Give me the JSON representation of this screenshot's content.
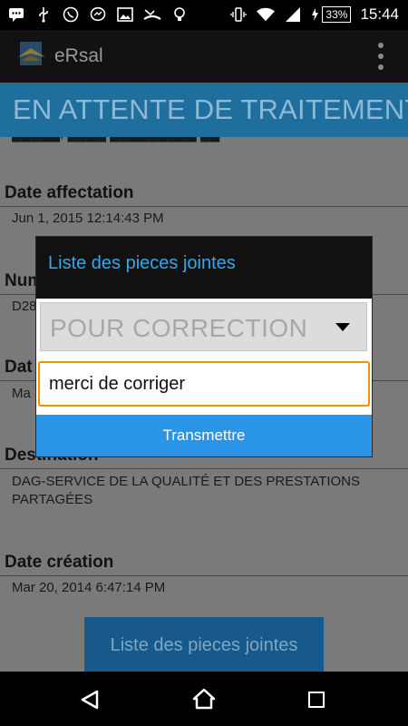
{
  "status_bar": {
    "notification_icons": [
      "chat-icon",
      "usb-icon",
      "whatsapp-icon",
      "messenger-icon",
      "image-icon",
      "missed-call-icon",
      "lightbulb-icon"
    ],
    "system_icons": [
      "vibrate-icon",
      "wifi-icon",
      "signal-icon",
      "battery-icon"
    ],
    "battery_percent": "33%",
    "time": "15:44"
  },
  "app_bar": {
    "title": "eRsal"
  },
  "banner": {
    "title": "EN ATTENTE DE TRAITEMENT"
  },
  "content": {
    "fields": [
      {
        "label": "Date affectation",
        "value": "Jun 1, 2015 12:14:43 PM"
      },
      {
        "label": "Numero d'ordre",
        "value": "D28"
      },
      {
        "label": "Dat",
        "value": "Ma"
      },
      {
        "label": "Destination",
        "value": "DAG-SERVICE DE LA QUALITÉ ET  DES PRESTATIONS PARTAGÉES"
      },
      {
        "label": "Date création",
        "value": "Mar 20, 2014 6:47:14 PM"
      }
    ],
    "list_button_label": "Liste des pieces jointes"
  },
  "dialog": {
    "title": "Liste des pieces jointes",
    "dropdown_selected": "POUR CORRECTION",
    "comment_value": "merci de corriger",
    "submit_label": "Transmettre"
  },
  "colors": {
    "banner": "#1e6f9e",
    "dialog_title": "#33a8ee",
    "submit_button": "#2a95e6",
    "input_focus_border": "#f29100"
  }
}
